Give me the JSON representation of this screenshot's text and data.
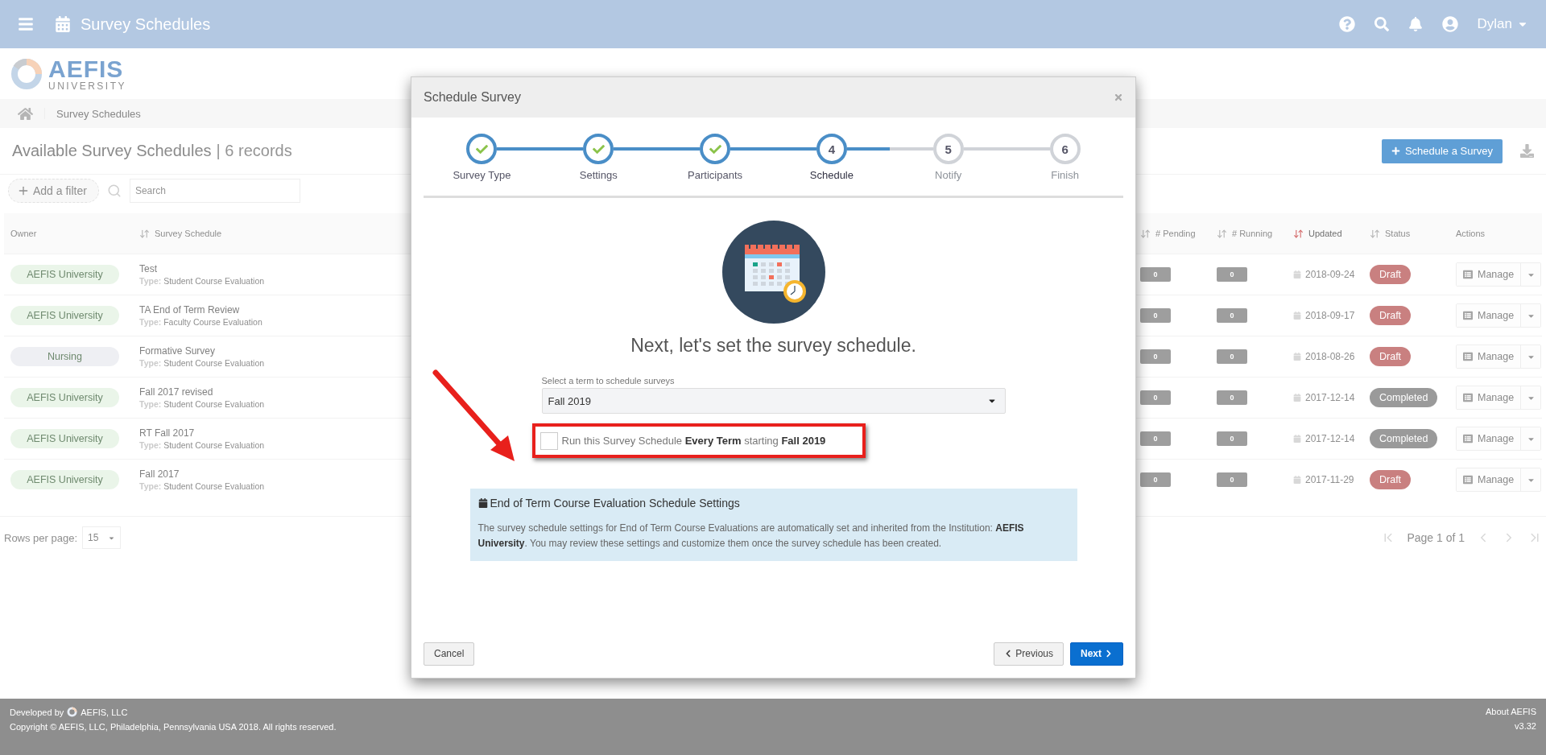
{
  "header": {
    "title": "Survey Schedules",
    "user": "Dylan"
  },
  "logo": {
    "name": "AEFIS",
    "sub": "UNIVERSITY"
  },
  "breadcrumb": [
    "Survey Schedules"
  ],
  "page": {
    "title": "Available Survey Schedules",
    "count": "| 6 records",
    "add_button": "Schedule a Survey"
  },
  "filter": {
    "label": "Add a filter",
    "search_placeholder": "Search"
  },
  "table": {
    "columns": [
      {
        "label": "Owner",
        "sortable": false,
        "sorted": false
      },
      {
        "label": "Survey Schedule",
        "sortable": true,
        "sorted": false
      },
      {
        "label": "# Pending",
        "sortable": true,
        "sorted": false
      },
      {
        "label": "# Running",
        "sortable": true,
        "sorted": false
      },
      {
        "label": "Updated",
        "sortable": true,
        "sorted": true
      },
      {
        "label": "Status",
        "sortable": true,
        "sorted": false
      },
      {
        "label": "Actions",
        "sortable": false,
        "sorted": false
      }
    ],
    "rows": [
      {
        "owner": "AEFIS University",
        "color": "#eaf5e9",
        "title": "Test",
        "type_label": "Type:",
        "type": "Student Course Evaluation",
        "pending": "0",
        "running": "0",
        "updated": "2018-09-24",
        "status": {
          "text": "Draft",
          "kind": "draft"
        },
        "action": "Manage"
      },
      {
        "owner": "AEFIS University",
        "color": "#eaf5e9",
        "title": "TA End of Term Review",
        "type_label": "Type:",
        "type": "Faculty Course Evaluation",
        "pending": "0",
        "running": "0",
        "updated": "2018-09-17",
        "status": {
          "text": "Draft",
          "kind": "draft"
        },
        "action": "Manage"
      },
      {
        "owner": "Nursing",
        "color": "#eeeff3",
        "title": "Formative Survey",
        "type_label": "Type:",
        "type": "Student Course Evaluation",
        "pending": "0",
        "running": "0",
        "updated": "2018-08-26",
        "status": {
          "text": "Draft",
          "kind": "draft"
        },
        "action": "Manage"
      },
      {
        "owner": "AEFIS University",
        "color": "#eaf5e9",
        "title": "Fall 2017 revised",
        "type_label": "Type:",
        "type": "Student Course Evaluation",
        "pending": "0",
        "running": "0",
        "updated": "2017-12-14",
        "status": {
          "text": "Completed",
          "kind": "completed"
        },
        "action": "Manage"
      },
      {
        "owner": "AEFIS University",
        "color": "#eaf5e9",
        "title": "RT Fall 2017",
        "type_label": "Type:",
        "type": "Student Course Evaluation",
        "pending": "0",
        "running": "0",
        "updated": "2017-12-14",
        "status": {
          "text": "Completed",
          "kind": "completed"
        },
        "action": "Manage"
      },
      {
        "owner": "AEFIS University",
        "color": "#eaf5e9",
        "title": "Fall 2017",
        "type_label": "Type:",
        "type": "Student Course Evaluation",
        "pending": "0",
        "running": "0",
        "updated": "2017-11-29",
        "status": {
          "text": "Draft",
          "kind": "draft"
        },
        "action": "Manage"
      }
    ]
  },
  "pagination": {
    "rows_label": "Rows per page:",
    "rows_value": "15",
    "page": "Page 1 of 1"
  },
  "footer": {
    "developed_by": "Developed by",
    "company": "AEFIS, LLC",
    "copyright": "Copyright © AEFIS, LLC, Philadelphia, Pennsylvania USA 2018. All rights reserved.",
    "about": "About AEFIS",
    "version": "v3.32"
  },
  "modal": {
    "title": "Schedule Survey",
    "steps": [
      {
        "label": "Survey Type",
        "done": true,
        "current": false
      },
      {
        "label": "Settings",
        "done": true,
        "current": false
      },
      {
        "label": "Participants",
        "done": true,
        "current": false
      },
      {
        "label": "Schedule",
        "number": "4",
        "done": false,
        "current": true
      },
      {
        "label": "Notify",
        "number": "5",
        "done": false,
        "current": false
      },
      {
        "label": "Finish",
        "number": "6",
        "done": false,
        "current": false
      }
    ],
    "heading": "Next, let's set the survey schedule.",
    "select": {
      "label": "Select a term to schedule surveys",
      "value": "Fall 2019"
    },
    "checkbox": {
      "checked": false,
      "text": "Run this Survey Schedule **Every Term** starting **Fall 2019**"
    },
    "info": {
      "title": "End of Term Course Evaluation Schedule Settings",
      "text": "The survey schedule settings for End of Term Course Evaluations are automatically set and inherited from the Institution: **AEFIS University**. You may review these settings and customize them once the survey schedule has been created."
    },
    "buttons": {
      "cancel": "Cancel",
      "previous": "Previous",
      "next": "Next"
    }
  }
}
